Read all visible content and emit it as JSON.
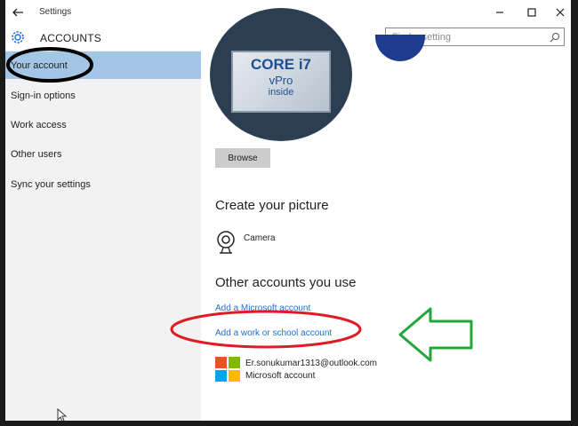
{
  "window": {
    "title": "Settings"
  },
  "header": {
    "title": "ACCOUNTS",
    "search_placeholder": "Find a setting"
  },
  "sidebar": {
    "items": [
      {
        "label": "Your account"
      },
      {
        "label": "Sign-in options"
      },
      {
        "label": "Work access"
      },
      {
        "label": "Other users"
      },
      {
        "label": "Sync your settings"
      }
    ]
  },
  "main": {
    "avatar_text": {
      "line1": "CORE i7",
      "line2": "vPro",
      "line3": "inside"
    },
    "browse_label": "Browse",
    "create_picture_heading": "Create your picture",
    "camera_label": "Camera",
    "other_accounts_heading": "Other accounts you use",
    "add_microsoft_account": "Add a Microsoft account",
    "add_work_school_account": "Add a work or school account",
    "account_email": "Er.sonukumar1313@outlook.com",
    "account_type": "Microsoft account"
  },
  "icons": {
    "back": "back-arrow-icon",
    "gear": "gear-icon",
    "search": "search-icon",
    "camera": "camera-icon"
  },
  "colors": {
    "selected_nav": "#a3c6e6",
    "link": "#1f6fd1",
    "annotation_black": "#000000",
    "annotation_red": "#e01b24",
    "annotation_green": "#22a83a"
  }
}
